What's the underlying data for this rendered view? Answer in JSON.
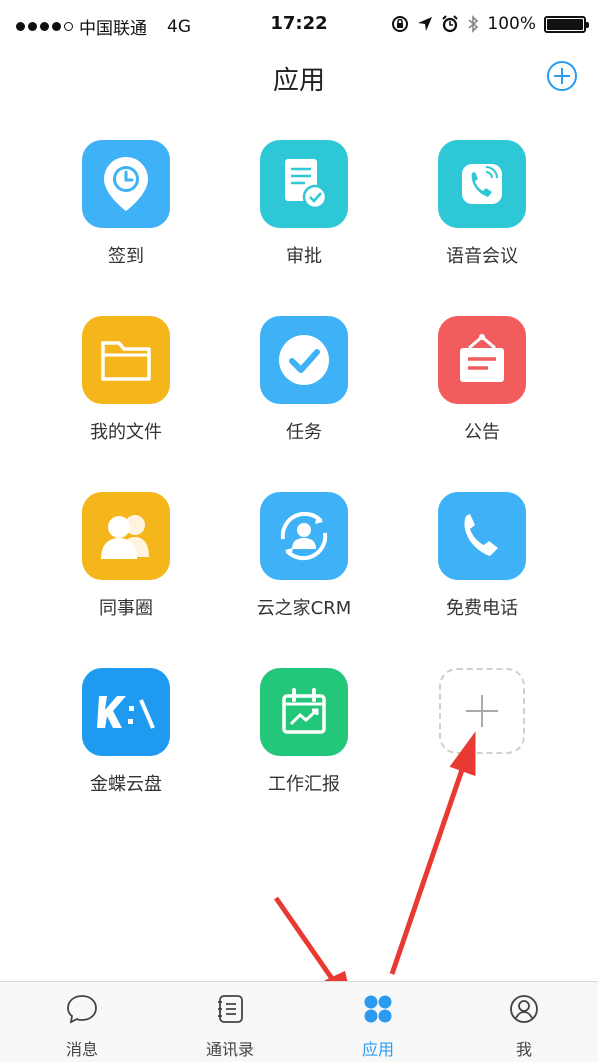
{
  "status_bar": {
    "carrier": "中国联通",
    "network": "4G",
    "time": "17:22",
    "battery": "100%",
    "battery_level": 1.0,
    "icons": [
      "signal-dots-icon",
      "lock-rotation-icon",
      "location-arrow-icon",
      "alarm-icon",
      "bluetooth-icon",
      "battery-icon"
    ]
  },
  "header": {
    "title": "应用"
  },
  "apps": [
    {
      "label": "签到",
      "icon": "location-pin-clock-icon",
      "color": "#3fb2f7"
    },
    {
      "label": "审批",
      "icon": "document-check-icon",
      "color": "#2ec7d6"
    },
    {
      "label": "语音会议",
      "icon": "phone-waves-icon",
      "color": "#2ec7d6"
    },
    {
      "label": "我的文件",
      "icon": "folder-icon",
      "color": "#f5b61c"
    },
    {
      "label": "任务",
      "icon": "check-circle-icon",
      "color": "#3fb2f7"
    },
    {
      "label": "公告",
      "icon": "notice-board-icon",
      "color": "#f25c5c"
    },
    {
      "label": "同事圈",
      "icon": "people-icon",
      "color": "#f5b61c"
    },
    {
      "label": "云之家CRM",
      "icon": "crm-person-cycle-icon",
      "color": "#3fb2f7"
    },
    {
      "label": "免费电话",
      "icon": "phone-icon",
      "color": "#3fb2f7"
    },
    {
      "label": "金蝶云盘",
      "icon": "kingdee-cloud-disk-icon",
      "color": "#1e9bf0"
    },
    {
      "label": "工作汇报",
      "icon": "calendar-chart-icon",
      "color": "#22c77a"
    }
  ],
  "tabs": [
    {
      "label": "消息",
      "icon": "chat-bubble-icon"
    },
    {
      "label": "通讯录",
      "icon": "contacts-book-icon"
    },
    {
      "label": "应用",
      "icon": "apps-grid-icon",
      "active": true
    },
    {
      "label": "我",
      "icon": "profile-icon"
    }
  ],
  "colors": {
    "accent": "#2a9bf0",
    "arrow": "#e83a33"
  }
}
